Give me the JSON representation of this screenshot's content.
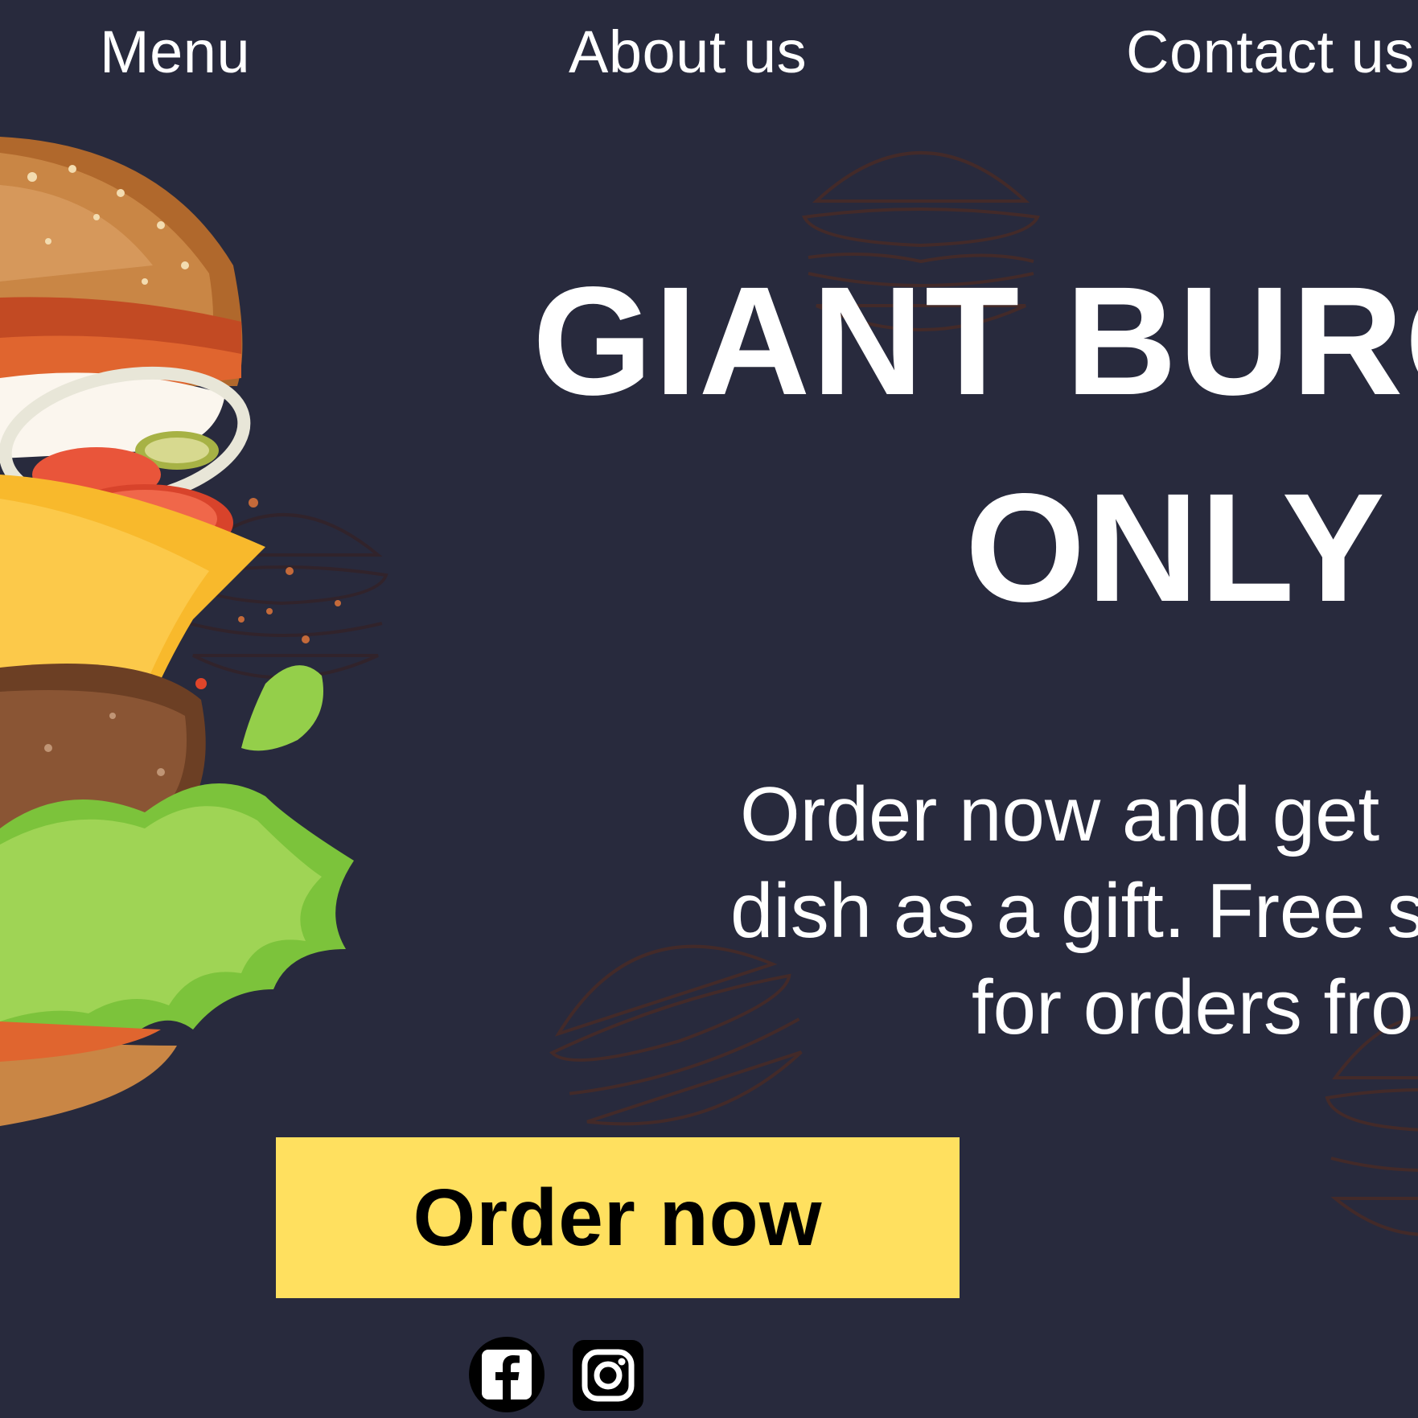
{
  "nav": {
    "items": [
      {
        "label": "Menu"
      },
      {
        "label": "About us"
      },
      {
        "label": "Contact us"
      }
    ]
  },
  "hero": {
    "headline_line1": "GIANT BURG",
    "headline_line2": "ONLY",
    "subtitle_lines": [
      "Order now and get",
      "dish as a gift. Free s",
      "for orders fro"
    ],
    "cta_label": "Order now",
    "image_subject": "burger-illustration"
  },
  "social": {
    "icons": [
      "facebook-icon",
      "instagram-icon"
    ]
  },
  "colors": {
    "background": "#282a3d",
    "accent": "#ffe05f",
    "text": "#ffffff",
    "sketch": "#5a2a1a"
  }
}
